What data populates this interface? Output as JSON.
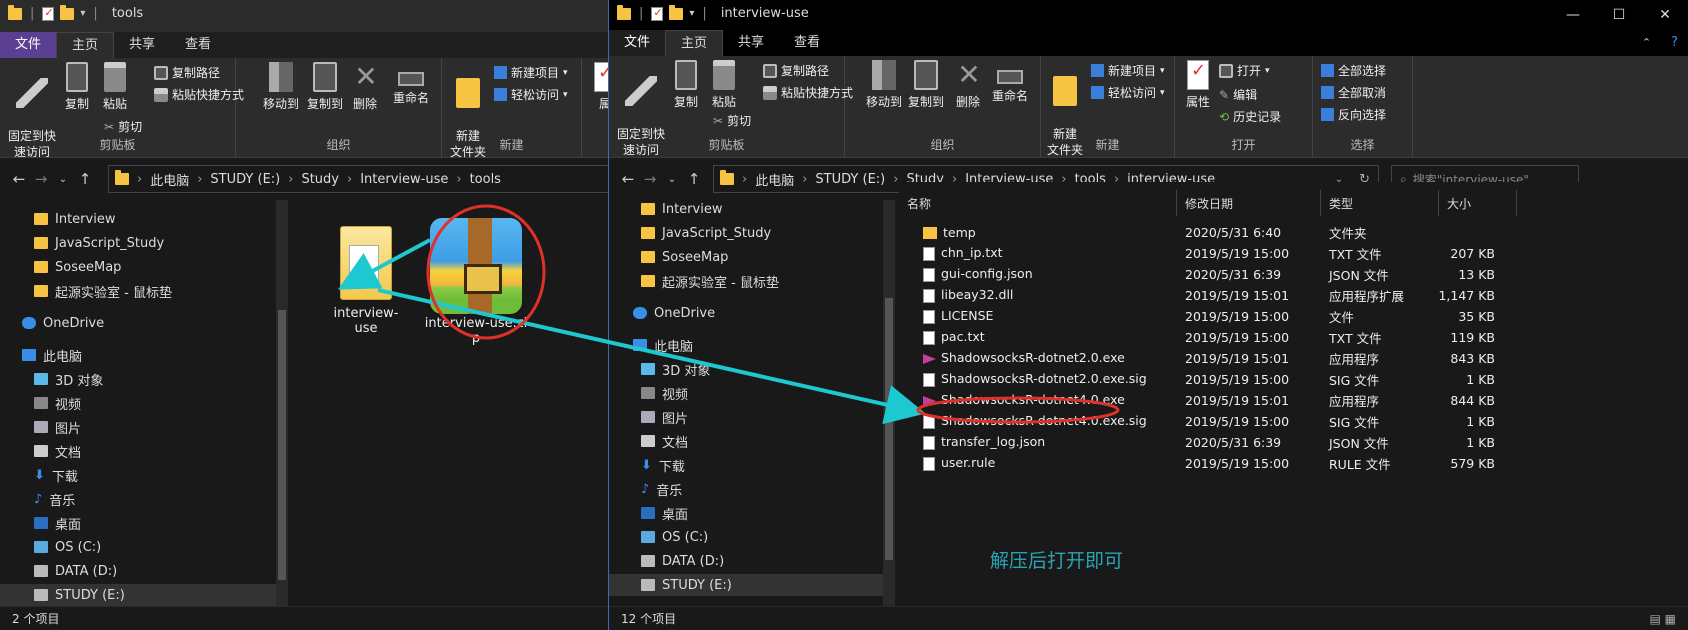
{
  "left_window": {
    "title": "tools",
    "tabs": [
      "文件",
      "主页",
      "共享",
      "查看"
    ],
    "ribbon": {
      "clipboard": {
        "pin_label": "固定到快\n速访问",
        "copy_label": "复制",
        "paste_label": "粘贴",
        "copy_path_label": "复制路径",
        "paste_shortcut_label": "粘贴快捷方式",
        "cut_label": "剪切",
        "group_label": "剪贴板"
      },
      "organize": {
        "move_to_label": "移动到",
        "copy_to_label": "复制到",
        "delete_label": "删除",
        "rename_label": "重命名",
        "group_label": "组织"
      },
      "new": {
        "new_folder_label": "新建\n文件夹",
        "new_item_label": "新建项目",
        "easy_access_label": "轻松访问",
        "group_label": "新建"
      },
      "open_partial_label": "属"
    },
    "breadcrumb": [
      "此电脑",
      "STUDY (E:)",
      "Study",
      "Interview-use",
      "tools"
    ],
    "nav": {
      "quick": [
        "Interview",
        "JavaScript_Study",
        "SoseeMap",
        "起源实验室 - 鼠标垫"
      ],
      "onedrive": "OneDrive",
      "this_pc": "此电脑",
      "pc_items": [
        "3D 对象",
        "视频",
        "图片",
        "文档",
        "下载",
        "音乐",
        "桌面",
        "OS (C:)",
        "DATA (D:)",
        "STUDY (E:)"
      ]
    },
    "items": [
      {
        "name": "interview-use"
      },
      {
        "name": "interview-use.zi",
        "name_wrap": "p"
      }
    ],
    "status": "2 个项目"
  },
  "right_window": {
    "title": "interview-use",
    "tabs": [
      "文件",
      "主页",
      "共享",
      "查看"
    ],
    "ribbon": {
      "clipboard": {
        "pin_label": "固定到快\n速访问",
        "copy_label": "复制",
        "paste_label": "粘贴",
        "copy_path_label": "复制路径",
        "paste_shortcut_label": "粘贴快捷方式",
        "cut_label": "剪切",
        "group_label": "剪贴板"
      },
      "organize": {
        "move_to_label": "移动到",
        "copy_to_label": "复制到",
        "delete_label": "删除",
        "rename_label": "重命名",
        "group_label": "组织"
      },
      "new": {
        "new_folder_label": "新建\n文件夹",
        "new_item_label": "新建项目",
        "easy_access_label": "轻松访问",
        "group_label": "新建"
      },
      "open": {
        "properties_label": "属性",
        "open_label": "打开",
        "edit_label": "编辑",
        "history_label": "历史记录",
        "group_label": "打开"
      },
      "select": {
        "select_all_label": "全部选择",
        "select_none_label": "全部取消",
        "invert_label": "反向选择",
        "group_label": "选择"
      }
    },
    "breadcrumb": [
      "此电脑",
      "STUDY (E:)",
      "Study",
      "Interview-use",
      "tools",
      "interview-use"
    ],
    "search_placeholder": "搜索\"interview-use\"",
    "nav": {
      "quick": [
        "Interview",
        "JavaScript_Study",
        "SoseeMap",
        "起源实验室 - 鼠标垫"
      ],
      "onedrive": "OneDrive",
      "this_pc": "此电脑",
      "pc_items": [
        "3D 对象",
        "视频",
        "图片",
        "文档",
        "下载",
        "音乐",
        "桌面",
        "OS (C:)",
        "DATA (D:)",
        "STUDY (E:)"
      ]
    },
    "columns": [
      "名称",
      "修改日期",
      "类型",
      "大小"
    ],
    "files": [
      {
        "name": "temp",
        "date": "2020/5/31 6:40",
        "type": "文件夹",
        "size": "",
        "icon": "folder-icon"
      },
      {
        "name": "chn_ip.txt",
        "date": "2019/5/19 15:00",
        "type": "TXT 文件",
        "size": "207 KB",
        "icon": "text-file-icon"
      },
      {
        "name": "gui-config.json",
        "date": "2020/5/31 6:39",
        "type": "JSON 文件",
        "size": "13 KB",
        "icon": "json-file-icon"
      },
      {
        "name": "libeay32.dll",
        "date": "2019/5/19 15:01",
        "type": "应用程序扩展",
        "size": "1,147 KB",
        "icon": "dll-file-icon"
      },
      {
        "name": "LICENSE",
        "date": "2019/5/19 15:00",
        "type": "文件",
        "size": "35 KB",
        "icon": "file-icon"
      },
      {
        "name": "pac.txt",
        "date": "2019/5/19 15:00",
        "type": "TXT 文件",
        "size": "119 KB",
        "icon": "text-file-icon"
      },
      {
        "name": "ShadowsocksR-dotnet2.0.exe",
        "date": "2019/5/19 15:01",
        "type": "应用程序",
        "size": "843 KB",
        "icon": "ssr-app-icon"
      },
      {
        "name": "ShadowsocksR-dotnet2.0.exe.sig",
        "date": "2019/5/19 15:00",
        "type": "SIG 文件",
        "size": "1 KB",
        "icon": "sig-file-icon"
      },
      {
        "name": "ShadowsocksR-dotnet4.0.exe",
        "date": "2019/5/19 15:01",
        "type": "应用程序",
        "size": "844 KB",
        "icon": "ssr-app-icon"
      },
      {
        "name": "ShadowsocksR-dotnet4.0.exe.sig",
        "date": "2019/5/19 15:00",
        "type": "SIG 文件",
        "size": "1 KB",
        "icon": "sig-file-icon"
      },
      {
        "name": "transfer_log.json",
        "date": "2020/5/31 6:39",
        "type": "JSON 文件",
        "size": "1 KB",
        "icon": "json-file-icon"
      },
      {
        "name": "user.rule",
        "date": "2019/5/19 15:00",
        "type": "RULE 文件",
        "size": "579 KB",
        "icon": "rule-file-icon"
      }
    ],
    "status": "12 个项目"
  },
  "annotation_text": "解压后打开即可",
  "colors": {
    "annotation": "#2aa4b4",
    "arrow": "#1ec8d0",
    "circle": "#e0302a",
    "file_tab_accent": "#5a3f93"
  }
}
